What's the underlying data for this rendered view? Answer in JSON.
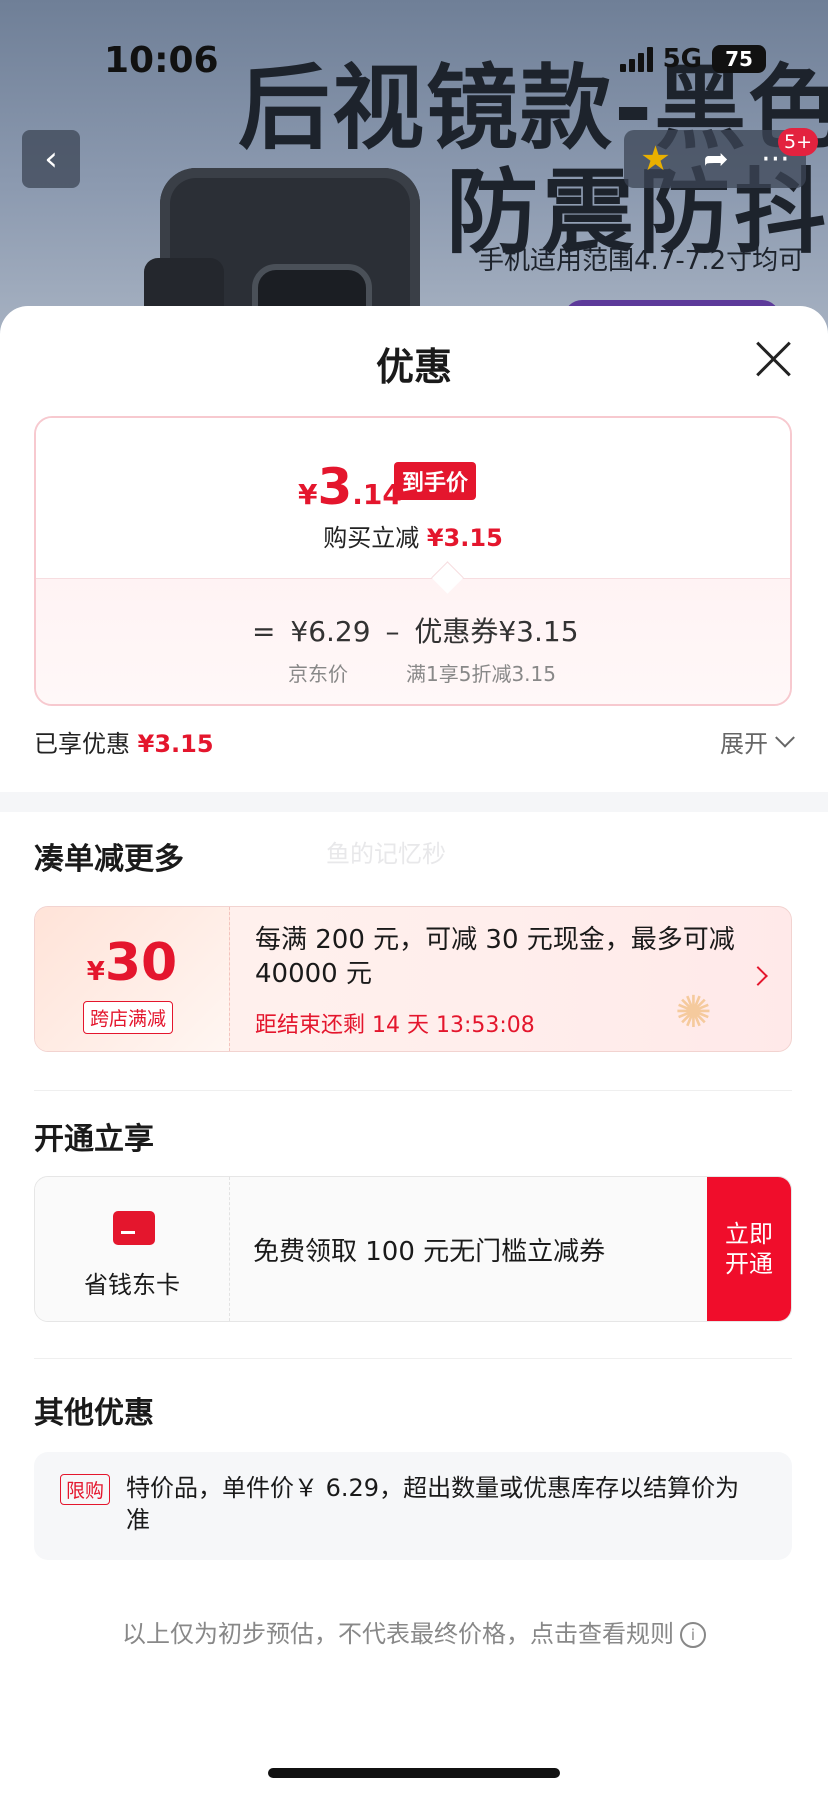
{
  "status_bar": {
    "time": "10:06",
    "network": "5G",
    "battery": "75"
  },
  "banner": {
    "headline_line1": "后视镜款-黑色",
    "headline_line2": "防震防抖",
    "subline": "手机适用范围4.7-7.2寸均可",
    "cart_badge": "5+",
    "icons": {
      "back": "back-icon",
      "favorite": "star-icon",
      "share": "share-icon",
      "more": "more-icon"
    }
  },
  "sheet": {
    "title": "优惠",
    "price_card": {
      "currency": "¥",
      "final_int": "3",
      "final_dec": ".14",
      "final_tag": "到手价",
      "instant_cut_label": "购买立减",
      "instant_cut_value": "¥3.15",
      "eq": "=",
      "base_price": "¥6.29",
      "minus": "–",
      "coupon_label": "优惠券¥3.15",
      "base_caption": "京东价",
      "coupon_caption": "满1享5折减3.15"
    },
    "enjoyed_label": "已享优惠",
    "enjoyed_value": "¥3.15",
    "expand_label": "展开",
    "section_more": "凑单减更多",
    "watermark": "鱼的记忆秒",
    "coupon30": {
      "currency": "¥",
      "amount": "30",
      "tag": "跨店满减",
      "desc": "每满 200 元，可减 30 元现金，最多可减 40000 元",
      "countdown": "距结束还剩 14 天 13:53:08"
    },
    "section_member": "开通立享",
    "member": {
      "name": "省钱东卡",
      "offer": "免费领取 100 元无门槛立减券",
      "button": "立即开通"
    },
    "section_other": "其他优惠",
    "other": {
      "tag": "限购",
      "text": "特价品，单件价￥ 6.29，超出数量或优惠库存以结算价为准"
    },
    "footnote": "以上仅为初步预估，不代表最终价格，点击查看规则"
  },
  "colors": {
    "accent_red": "#e4162d",
    "button_red": "#f00d2b"
  }
}
